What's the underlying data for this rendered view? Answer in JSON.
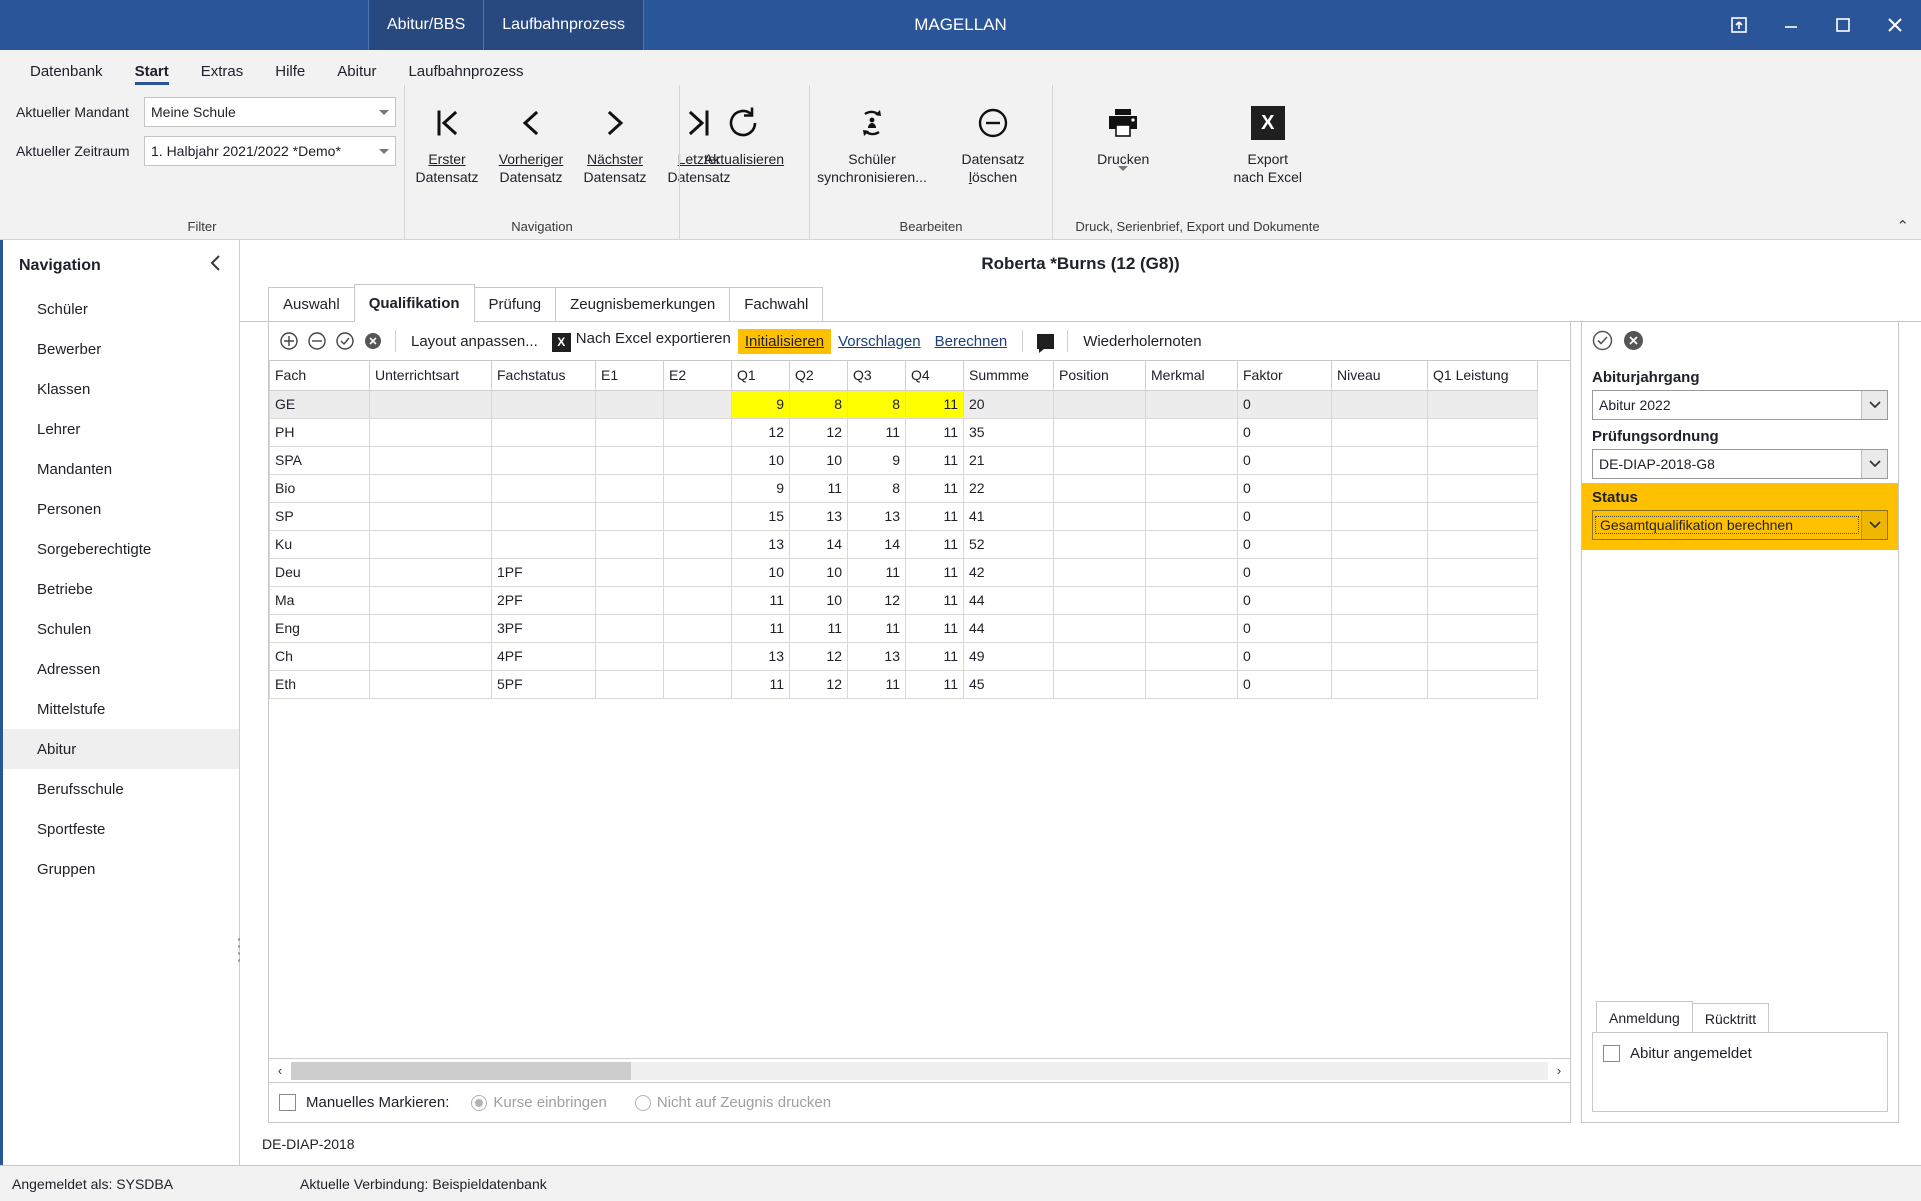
{
  "window": {
    "title": "MAGELLAN",
    "doc_tabs": [
      {
        "label": "Abitur/BBS"
      },
      {
        "label": "Laufbahnprozess"
      }
    ],
    "controls": {
      "restore_down_label": "restore-window",
      "minimize_label": "minimize",
      "maximize_label": "maximize",
      "close_label": "close"
    }
  },
  "menubar": {
    "items": [
      {
        "label": "Datenbank",
        "active": false
      },
      {
        "label": "Start",
        "active": true
      },
      {
        "label": "Extras",
        "active": false
      },
      {
        "label": "Hilfe",
        "active": false
      },
      {
        "label": "Abitur",
        "active": false
      },
      {
        "label": "Laufbahnprozess",
        "active": false
      }
    ]
  },
  "ribbon": {
    "filter": {
      "group_label": "Filter",
      "mandant_label": "Aktueller Mandant",
      "mandant_value": "Meine Schule",
      "zeitraum_label": "Aktueller Zeitraum",
      "zeitraum_value": "1. Halbjahr 2021/2022 *Demo*"
    },
    "navigation": {
      "group_label": "Navigation",
      "buttons": [
        {
          "line1": "Erster",
          "line2": "Datensatz",
          "accel": "E",
          "icon": "first-record-icon"
        },
        {
          "line1": "Vorheriger",
          "line2": "Datensatz",
          "accel": "V",
          "icon": "previous-record-icon"
        },
        {
          "line1": "Nächster",
          "line2": "Datensatz",
          "accel": "N",
          "icon": "next-record-icon"
        },
        {
          "line1": "Letzter",
          "line2": "Datensatz",
          "accel": "L",
          "icon": "last-record-icon"
        }
      ]
    },
    "refresh": {
      "label": "Aktualisieren",
      "accel": "A",
      "icon": "refresh-icon"
    },
    "edit": {
      "group_label": "Bearbeiten",
      "buttons": [
        {
          "line1": "Schüler",
          "line2": "synchronisieren...",
          "icon": "sync-student-icon"
        },
        {
          "line1": "Datensatz",
          "line2": "löschen",
          "accel": "l",
          "icon": "delete-record-icon"
        }
      ]
    },
    "print": {
      "group_label": "Druck, Serienbrief, Export und Dokumente",
      "buttons": [
        {
          "line1": "Drucken",
          "line2": "",
          "icon": "printer-icon",
          "has_caret": true
        },
        {
          "line1": "Export",
          "line2": "nach Excel",
          "icon": "excel-icon",
          "has_caret": false
        }
      ]
    },
    "collapse_label": "⌃"
  },
  "sidebar": {
    "title": "Navigation",
    "collapse_icon": "chevron-left-icon",
    "items": [
      {
        "label": "Schüler",
        "active": false
      },
      {
        "label": "Bewerber",
        "active": false
      },
      {
        "label": "Klassen",
        "active": false
      },
      {
        "label": "Lehrer",
        "active": false
      },
      {
        "label": "Mandanten",
        "active": false
      },
      {
        "label": "Personen",
        "active": false
      },
      {
        "label": "Sorgeberechtigte",
        "active": false
      },
      {
        "label": "Betriebe",
        "active": false
      },
      {
        "label": "Schulen",
        "active": false
      },
      {
        "label": "Adressen",
        "active": false
      },
      {
        "label": "Mittelstufe",
        "active": false
      },
      {
        "label": "Abitur",
        "active": true
      },
      {
        "label": "Berufsschule",
        "active": false
      },
      {
        "label": "Sportfeste",
        "active": false
      },
      {
        "label": "Gruppen",
        "active": false
      }
    ]
  },
  "content": {
    "record_title": "Roberta *Burns (12 (G8))",
    "tabs": [
      {
        "label": "Auswahl",
        "active": false
      },
      {
        "label": "Qualifikation",
        "active": true
      },
      {
        "label": "Prüfung",
        "active": false
      },
      {
        "label": "Zeugnisbemerkungen",
        "active": false
      },
      {
        "label": "Fachwahl",
        "active": false
      }
    ],
    "toolbar": {
      "icons": [
        {
          "name": "add-icon",
          "glyph": "⊕"
        },
        {
          "name": "remove-icon",
          "glyph": "⊖"
        },
        {
          "name": "confirm-icon",
          "glyph": "⊘"
        },
        {
          "name": "cancel-icon",
          "glyph": "⊗"
        }
      ],
      "layout_label": "Layout anpassen...",
      "excel_label": "Nach Excel exportieren",
      "excel_icon_text": "X",
      "initialisieren_label": "Initialisieren",
      "initialisieren_accel": "I",
      "vorschlagen_label": "Vorschlagen",
      "vorschlagen_accel": "V",
      "berechnen_label": "Berechnen",
      "berechnen_accel": "B",
      "comment_icon": "comment-icon",
      "wiederholernoten_label": "Wiederholernoten"
    },
    "grid": {
      "columns": [
        "Fach",
        "Unterrichtsart",
        "Fachstatus",
        "E1",
        "E2",
        "Q1",
        "Q2",
        "Q3",
        "Q4",
        "Summme",
        "Position",
        "Merkmal",
        "Faktor",
        "Niveau",
        "Q1 Leistung"
      ],
      "rows": [
        {
          "fach": "GE",
          "unterrichtsart": "",
          "fachstatus": "",
          "e1": "",
          "e2": "",
          "q1": "9",
          "q2": "8",
          "q3": "8",
          "q4": "11",
          "summe": "20",
          "position": "",
          "merkmal": "",
          "faktor": "0",
          "niveau": "",
          "q1l": "",
          "selected": true
        },
        {
          "fach": "PH",
          "unterrichtsart": "",
          "fachstatus": "",
          "e1": "",
          "e2": "",
          "q1": "12",
          "q2": "12",
          "q3": "11",
          "q4": "11",
          "summe": "35",
          "position": "",
          "merkmal": "",
          "faktor": "0",
          "niveau": "",
          "q1l": "",
          "selected": false
        },
        {
          "fach": "SPA",
          "unterrichtsart": "",
          "fachstatus": "",
          "e1": "",
          "e2": "",
          "q1": "10",
          "q2": "10",
          "q3": "9",
          "q4": "11",
          "summe": "21",
          "position": "",
          "merkmal": "",
          "faktor": "0",
          "niveau": "",
          "q1l": "",
          "selected": false
        },
        {
          "fach": "Bio",
          "unterrichtsart": "",
          "fachstatus": "",
          "e1": "",
          "e2": "",
          "q1": "9",
          "q2": "11",
          "q3": "8",
          "q4": "11",
          "summe": "22",
          "position": "",
          "merkmal": "",
          "faktor": "0",
          "niveau": "",
          "q1l": "",
          "selected": false
        },
        {
          "fach": "SP",
          "unterrichtsart": "",
          "fachstatus": "",
          "e1": "",
          "e2": "",
          "q1": "15",
          "q2": "13",
          "q3": "13",
          "q4": "11",
          "summe": "41",
          "position": "",
          "merkmal": "",
          "faktor": "0",
          "niveau": "",
          "q1l": "",
          "selected": false
        },
        {
          "fach": "Ku",
          "unterrichtsart": "",
          "fachstatus": "",
          "e1": "",
          "e2": "",
          "q1": "13",
          "q2": "14",
          "q3": "14",
          "q4": "11",
          "summe": "52",
          "position": "",
          "merkmal": "",
          "faktor": "0",
          "niveau": "",
          "q1l": "",
          "selected": false
        },
        {
          "fach": "Deu",
          "unterrichtsart": "",
          "fachstatus": "1PF",
          "e1": "",
          "e2": "",
          "q1": "10",
          "q2": "10",
          "q3": "11",
          "q4": "11",
          "summe": "42",
          "position": "",
          "merkmal": "",
          "faktor": "0",
          "niveau": "",
          "q1l": "",
          "selected": false
        },
        {
          "fach": "Ma",
          "unterrichtsart": "",
          "fachstatus": "2PF",
          "e1": "",
          "e2": "",
          "q1": "11",
          "q2": "10",
          "q3": "12",
          "q4": "11",
          "summe": "44",
          "position": "",
          "merkmal": "",
          "faktor": "0",
          "niveau": "",
          "q1l": "",
          "selected": false
        },
        {
          "fach": "Eng",
          "unterrichtsart": "",
          "fachstatus": "3PF",
          "e1": "",
          "e2": "",
          "q1": "11",
          "q2": "11",
          "q3": "11",
          "q4": "11",
          "summe": "44",
          "position": "",
          "merkmal": "",
          "faktor": "0",
          "niveau": "",
          "q1l": "",
          "selected": false
        },
        {
          "fach": "Ch",
          "unterrichtsart": "",
          "fachstatus": "4PF",
          "e1": "",
          "e2": "",
          "q1": "13",
          "q2": "12",
          "q3": "13",
          "q4": "11",
          "summe": "49",
          "position": "",
          "merkmal": "",
          "faktor": "0",
          "niveau": "",
          "q1l": "",
          "selected": false
        },
        {
          "fach": "Eth",
          "unterrichtsart": "",
          "fachstatus": "5PF",
          "e1": "",
          "e2": "",
          "q1": "11",
          "q2": "12",
          "q3": "11",
          "q4": "11",
          "summe": "45",
          "position": "",
          "merkmal": "",
          "faktor": "0",
          "niveau": "",
          "q1l": "",
          "selected": false
        }
      ]
    },
    "grid_footer": {
      "manual_mark_label": "Manuelles Markieren:",
      "radio1_label": "Kurse einbringen",
      "radio2_label": "Nicht auf Zeugnis drucken",
      "radio1_selected": true,
      "radio2_selected": false,
      "checkbox_checked": false
    },
    "footnote": "DE-DIAP-2018"
  },
  "rightpanel": {
    "confirm_icon": "confirm-circle-icon",
    "cancel_icon": "cancel-circle-icon",
    "abiturjahrgang_label": "Abiturjahrgang",
    "abiturjahrgang_value": "Abitur 2022",
    "pruefungsordnung_label": "Prüfungsordnung",
    "pruefungsordnung_value": "DE-DIAP-2018-G8",
    "status_label": "Status",
    "status_value": "Gesamtqualifikation berechnen",
    "tabs": [
      {
        "label": "Anmeldung",
        "active": true
      },
      {
        "label": "Rücktritt",
        "active": false
      }
    ],
    "checkbox_label": "Abitur angemeldet",
    "checkbox_checked": false
  },
  "statusbar": {
    "logged_in": "Angemeldet als: SYSDBA",
    "connection": "Aktuelle Verbindung: Beispieldatenbank"
  },
  "colors": {
    "titlebar": "#2a5699",
    "accent": "#2a5699",
    "highlight": "#ffc000",
    "grade_cell": "#ffff00"
  }
}
